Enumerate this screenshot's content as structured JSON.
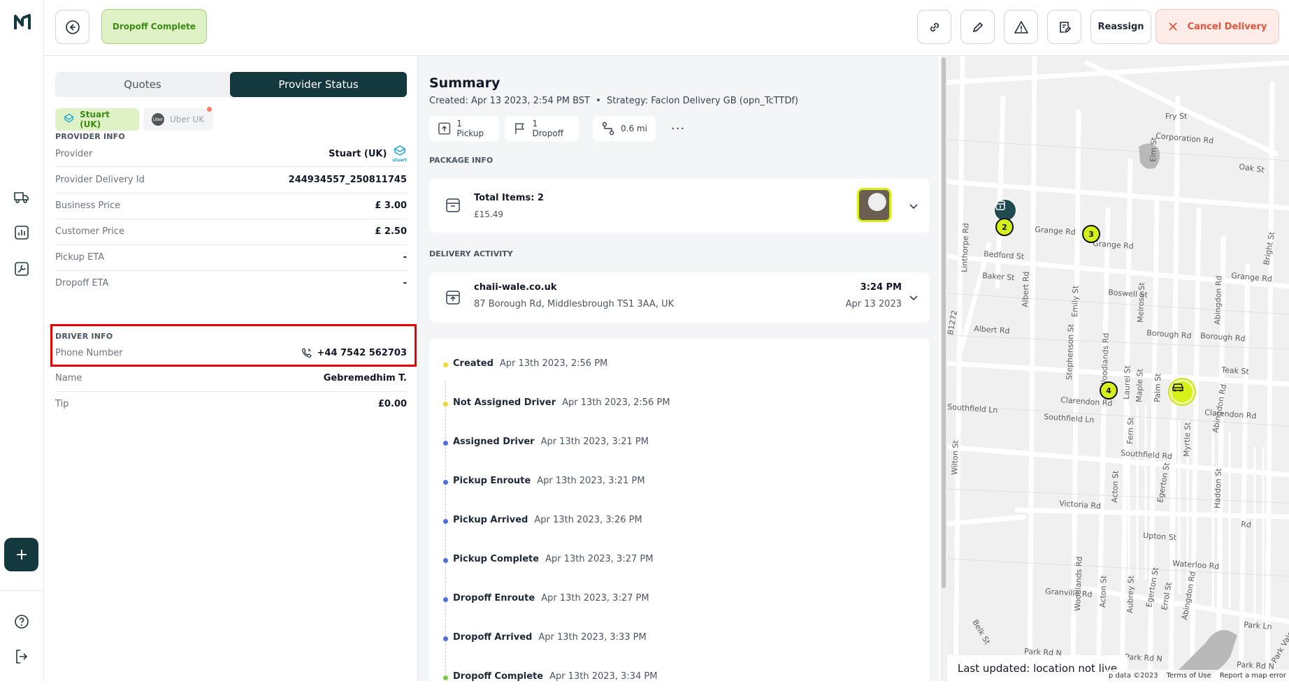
{
  "topbar": {
    "status": "Dropoff Complete",
    "reassign_label": "Reassign",
    "cancel_label": "Cancel Delivery"
  },
  "provider_panel": {
    "tabs": [
      "Quotes",
      "Provider Status"
    ],
    "active_tab": "Provider Status",
    "providers": [
      {
        "name": "Stuart (UK)",
        "selected": true
      },
      {
        "name": "Uber UK",
        "selected": false
      }
    ],
    "provider_info_title": "PROVIDER INFO",
    "provider_info": [
      {
        "label": "Provider",
        "value": "Stuart (UK)"
      },
      {
        "label": "Provider Delivery Id",
        "value": "244934557_250811745"
      },
      {
        "label": "Business Price",
        "value": "£ 3.00"
      },
      {
        "label": "Customer Price",
        "value": "£ 2.50"
      },
      {
        "label": "Pickup ETA",
        "value": "-"
      },
      {
        "label": "Dropoff ETA",
        "value": "-"
      }
    ],
    "stuart_logo_text": "stuart",
    "uber_logo_text": "Uber",
    "driver_info_title": "DRIVER INFO",
    "driver_info": [
      {
        "label": "Phone Number",
        "value": "+44 7542 562703"
      },
      {
        "label": "Name",
        "value": "Gebremedhim T."
      },
      {
        "label": "Tip",
        "value": "£0.00"
      }
    ]
  },
  "summary": {
    "title": "Summary",
    "created": "Created: Apr 13 2023, 2:54 PM BST",
    "separator": "•",
    "strategy": "Strategy: Faclon Delivery GB (opn_TcTTDf)",
    "pickups": "1 Pickup",
    "dropoffs": "1 Dropoff",
    "distance": "0.6 mi",
    "more": "···",
    "package_label": "PACKAGE INFO",
    "package_total": "Total Items: 2",
    "package_price": "£15.49",
    "activity_label": "DELIVERY ACTIVITY",
    "activity": {
      "name": "chaii-wale.co.uk",
      "address": "87 Borough Rd, Middlesbrough TS1 3AA, UK",
      "time": "3:24 PM",
      "date": "Apr 13 2023"
    },
    "timeline": [
      {
        "name": "Created",
        "time": "Apr 13th 2023, 2:56 PM",
        "color": "#f2d630"
      },
      {
        "name": "Not Assigned Driver",
        "time": "Apr 13th 2023, 2:56 PM",
        "color": "#f2d630"
      },
      {
        "name": "Assigned Driver",
        "time": "Apr 13th 2023, 3:21 PM",
        "color": "#4f6fe0"
      },
      {
        "name": "Pickup Enroute",
        "time": "Apr 13th 2023, 3:21 PM",
        "color": "#4f6fe0"
      },
      {
        "name": "Pickup Arrived",
        "time": "Apr 13th 2023, 3:26 PM",
        "color": "#4f6fe0"
      },
      {
        "name": "Pickup Complete",
        "time": "Apr 13th 2023, 3:27 PM",
        "color": "#4f6fe0"
      },
      {
        "name": "Dropoff Enroute",
        "time": "Apr 13th 2023, 3:27 PM",
        "color": "#4f6fe0"
      },
      {
        "name": "Dropoff Arrived",
        "time": "Apr 13th 2023, 3:33 PM",
        "color": "#4f6fe0"
      },
      {
        "name": "Dropoff Complete",
        "time": "Apr 13th 2023, 3:34 PM",
        "color": "#7ac943"
      }
    ]
  },
  "map": {
    "streets": [
      "Fry St",
      "Corporation Rd",
      "Oak St",
      "Grange Rd",
      "Bedford St",
      "Baker St",
      "Boswell St",
      "Albert Rd",
      "Borough Rd",
      "Teak St",
      "Clarendon Rd",
      "Southfield Ln",
      "Southfield Rd",
      "Victoria Rd",
      "Upton St",
      "Waterloo Rd",
      "Granville Rd",
      "Park Ln",
      "Park Rd N",
      "Park Vale Rd",
      "Linthorpe Rd",
      "Melrose St",
      "Woodlands Rd",
      "Stephenson St",
      "Abingdon Rd",
      "Wilton St",
      "Laurel St",
      "Maple St",
      "Palm St",
      "Fern St",
      "Myrtle St",
      "Egerton St",
      "Haddon St",
      "Acton St",
      "Aubrey St",
      "Errol St",
      "Belk St",
      "Elm St",
      "Emily St",
      "Bright St",
      "B1272",
      "Borough Rd",
      "Borough Rd"
    ],
    "pins": [
      "2",
      "3",
      "4"
    ],
    "status": "Last updated: location not live",
    "footer": [
      "p data ©2023",
      "Terms of Use",
      "Report a map error"
    ]
  }
}
